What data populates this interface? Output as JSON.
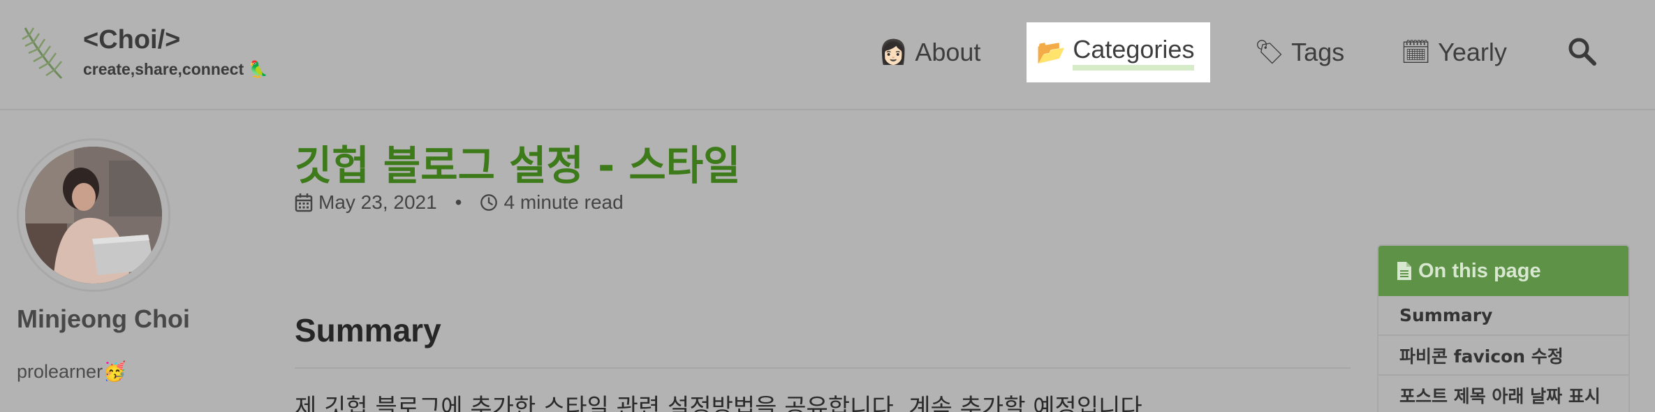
{
  "site": {
    "title": "<Choi/>",
    "subtitle": "create,share,connect",
    "subtitle_emoji": "🦜"
  },
  "nav": {
    "items": [
      {
        "label": "About",
        "emoji": "👩🏻"
      },
      {
        "label": "Categories",
        "emoji": "📂"
      },
      {
        "label": "Tags",
        "emoji": "🏷"
      },
      {
        "label": "Yearly",
        "emoji": "🗓"
      }
    ],
    "active": "Categories"
  },
  "author": {
    "name": "Minjeong Choi",
    "bio": "prolearner🥳"
  },
  "article": {
    "title": "깃헙 블로그 설정 - 스타일",
    "date": "May 23, 2021",
    "separator": "•",
    "read_time": "4 minute read",
    "section_heading": "Summary",
    "summary": "제 깃헙 블로그에 추가한 스타일 관련 설정방법을 공유합니다. 계속 추가할 예정입니다."
  },
  "toc": {
    "title": "On this page",
    "items": [
      "Summary",
      "파비콘 favicon 수정",
      "포스트 제목 아래 날짜 표시"
    ]
  },
  "colors": {
    "background": "#b3b3b3",
    "title_green": "#3d7a1a",
    "toc_header": "#5e9247",
    "active_underline": "#d6ecc8"
  }
}
